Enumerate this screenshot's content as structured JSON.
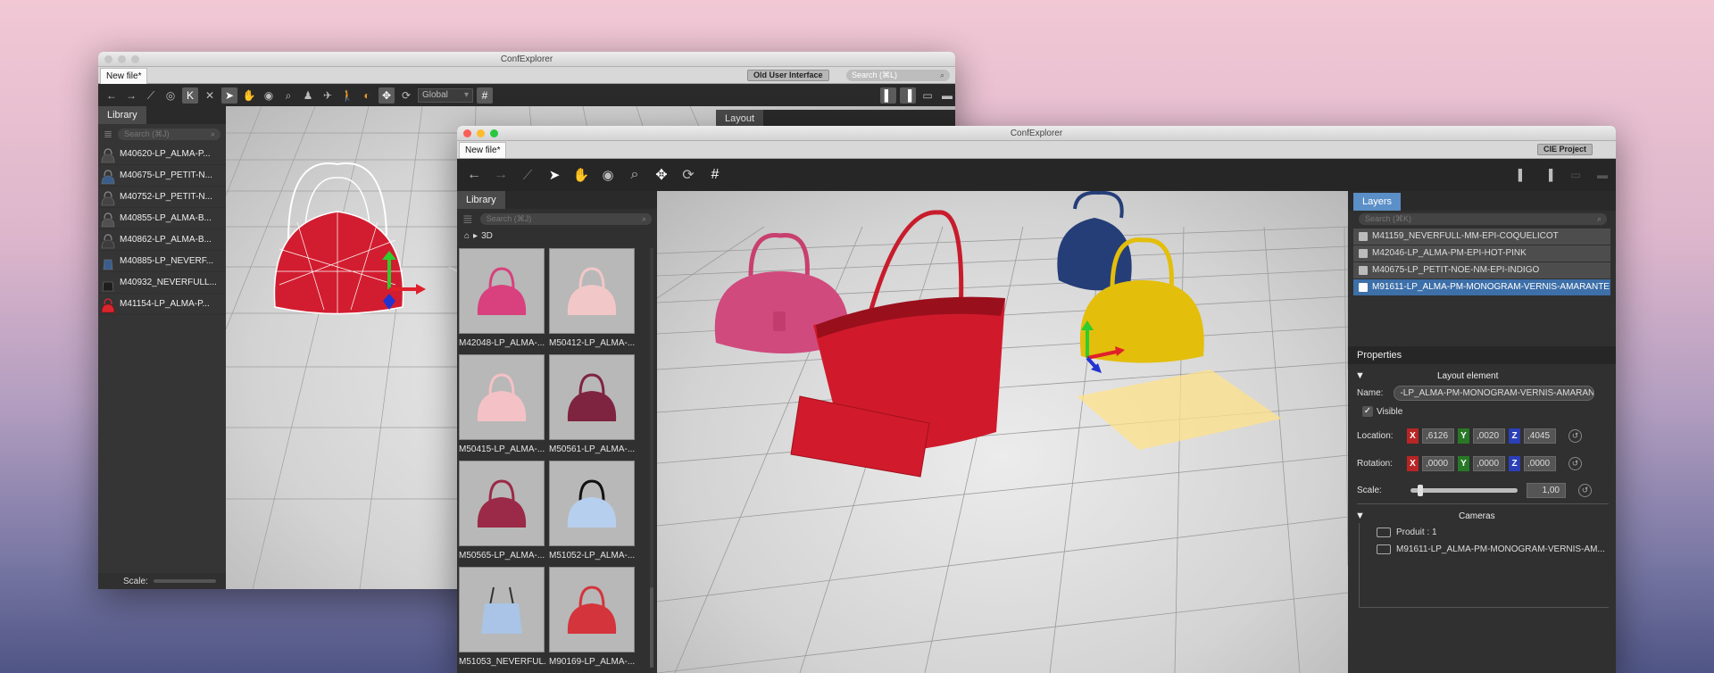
{
  "back_window": {
    "title": "ConfExplorer",
    "tab_label": "New file*",
    "old_ui_button": "Old User Interface",
    "search_placeholder": "Search (⌘L)",
    "coord_select": "Global",
    "library_tab": "Library",
    "library_search": "Search (⌘J)",
    "layout_tab": "Layout",
    "scale_label": "Scale:",
    "library_items": [
      {
        "label": "M40620-LP_ALMA-P...",
        "color": "#4a4a4a"
      },
      {
        "label": "M40675-LP_PETIT-N...",
        "color": "#3b5d8c"
      },
      {
        "label": "M40752-LP_PETIT-N...",
        "color": "#444444"
      },
      {
        "label": "M40855-LP_ALMA-B...",
        "color": "#505050"
      },
      {
        "label": "M40862-LP_ALMA-B...",
        "color": "#3c3c3c"
      },
      {
        "label": "M40885-LP_NEVERF...",
        "color": "#3b5d8c"
      },
      {
        "label": "M40932_NEVERFULL...",
        "color": "#222222"
      },
      {
        "label": "M41154-LP_ALMA-P...",
        "color": "#d8262e"
      }
    ]
  },
  "front_window": {
    "title": "ConfExplorer",
    "tab_label": "New file*",
    "project_button": "CIE Project",
    "library_tab": "Library",
    "library_search": "Search (⌘J)",
    "breadcrumb": "3D",
    "tiles": [
      {
        "label": "M42048-LP_ALMA-...",
        "color": "#d8417e"
      },
      {
        "label": "M50412-LP_ALMA-...",
        "color": "#f2c7c8"
      },
      {
        "label": "M50415-LP_ALMA-...",
        "color": "#f4c2c6"
      },
      {
        "label": "M50561-LP_ALMA-...",
        "color": "#7e2340"
      },
      {
        "label": "M50565-LP_ALMA-...",
        "color": "#9a2a47"
      },
      {
        "label": "M51052-LP_ALMA-...",
        "color": "#b7cfee"
      },
      {
        "label": "M51053_NEVERFUL...",
        "color": "#a9c4e6"
      },
      {
        "label": "M90169-LP_ALMA-...",
        "color": "#d4343c"
      }
    ],
    "layers_tab": "Layers",
    "layers_search": "Search (⌘K)",
    "layers": [
      {
        "label": "M41159_NEVERFULL-MM-EPI-COQUELICOT",
        "selected": false
      },
      {
        "label": "M42046-LP_ALMA-PM-EPI-HOT-PINK",
        "selected": false
      },
      {
        "label": "M40675-LP_PETIT-NOE-NM-EPI-INDIGO",
        "selected": false
      },
      {
        "label": "M91611-LP_ALMA-PM-MONOGRAM-VERNIS-AMARANTE",
        "selected": true
      }
    ],
    "properties": {
      "tab": "Properties",
      "section": "Layout element",
      "name_label": "Name:",
      "name_value": "-LP_ALMA-PM-MONOGRAM-VERNIS-AMARANTE",
      "visible_label": "Visible",
      "visible": true,
      "location_label": "Location:",
      "location": {
        "x": ",6126",
        "y": ",0020",
        "z": ",4045"
      },
      "rotation_label": "Rotation:",
      "rotation": {
        "x": ",0000",
        "y": ",0000",
        "z": ",0000"
      },
      "scale_label": "Scale:",
      "scale_value": "1,00",
      "axis_x": "X",
      "axis_y": "Y",
      "axis_z": "Z"
    },
    "cameras": {
      "header": "Cameras",
      "items": [
        "Produit : 1",
        "M91611-LP_ALMA-PM-MONOGRAM-VERNIS-AM..."
      ]
    }
  },
  "colors": {
    "accent_blue": "#5b8fc8",
    "selection_blue": "#3d6fa8",
    "axis_x": "#c8262b",
    "axis_y": "#2c8a2c",
    "axis_z": "#2a3fb8",
    "bag_red": "#d01a2c",
    "bag_pink": "#d04a7d",
    "bag_navy": "#253e78",
    "bag_yellow": "#e3be0b"
  }
}
